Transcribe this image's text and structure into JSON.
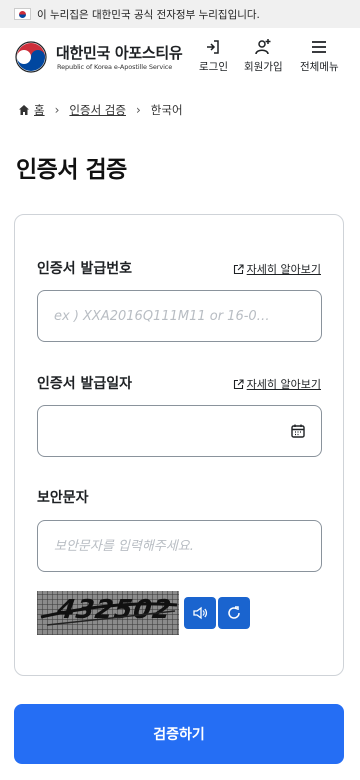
{
  "gov_bar": {
    "text": "이 누리집은 대한민국 공식 전자정부 누리집입니다."
  },
  "header": {
    "brand_title": "대한민국 아포스티유",
    "brand_subtitle": "Republic of Korea e-Apostille Service",
    "nav": [
      {
        "label": "로그인",
        "icon": "login-icon"
      },
      {
        "label": "회원가입",
        "icon": "user-plus-icon"
      },
      {
        "label": "전체메뉴",
        "icon": "hamburger-menu-icon"
      }
    ]
  },
  "breadcrumb": {
    "home": "홈",
    "parent": "인증서 검증",
    "current": "한국어"
  },
  "page_title": "인증서 검증",
  "form": {
    "cert_number": {
      "label": "인증서 발급번호",
      "more": "자세히 알아보기",
      "placeholder": "ex ) XXA2016Q111M11 or 16-0…",
      "value": ""
    },
    "issue_date": {
      "label": "인증서 발급일자",
      "more": "자세히 알아보기",
      "value": ""
    },
    "security_text": {
      "label": "보안문자",
      "placeholder": "보안문자를 입력해주세요.",
      "value": ""
    },
    "captcha_text": "432502"
  },
  "submit_label": "검증하기",
  "colors": {
    "primary": "#256ef4",
    "captcha_button": "#1a64cf",
    "text": "#1e2124"
  }
}
